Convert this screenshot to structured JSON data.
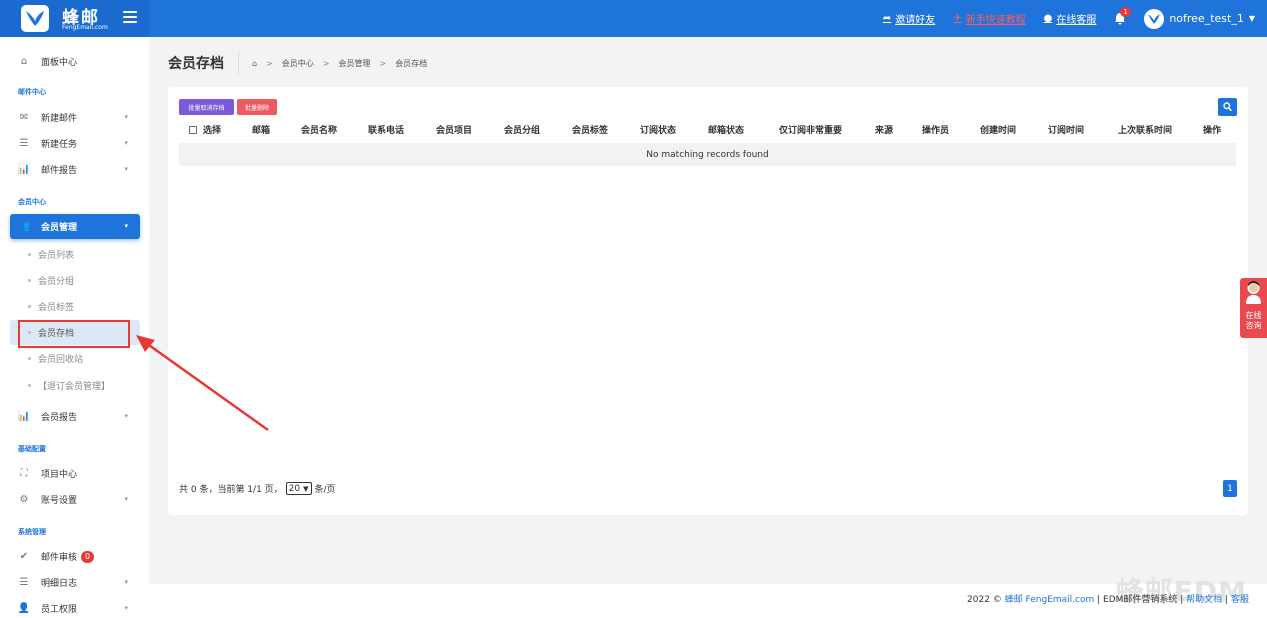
{
  "brand": {
    "name": "蜂邮",
    "domain": "FengEmail.com"
  },
  "header": {
    "invite": "邀请好友",
    "tutorial": "新手快速教程",
    "support": "在线客服",
    "notif_count": "1",
    "username": "nofree_test_1"
  },
  "sidebar": {
    "dashboard": "面板中心",
    "group_mail": "邮件中心",
    "new_mail": "新建邮件",
    "new_task": "新建任务",
    "mail_report": "邮件报告",
    "group_member": "会员中心",
    "member_mgmt": "会员管理",
    "member_list": "会员列表",
    "member_group": "会员分组",
    "member_tag": "会员标签",
    "member_archive": "会员存档",
    "member_recycle": "会员回收站",
    "unsub_mgmt": "【退订会员管理】",
    "member_report": "会员报告",
    "group_config": "基础配置",
    "project_center": "项目中心",
    "account_settings": "账号设置",
    "group_system": "系统管理",
    "mail_review": "邮件审核",
    "mail_review_count": "0",
    "detail_log": "明细日志",
    "staff_perm": "员工权限"
  },
  "page": {
    "title": "会员存档",
    "breadcrumb": [
      "会员中心",
      "会员管理",
      "会员存档"
    ]
  },
  "toolbar": {
    "batch_unarchive": "批量取消存档",
    "batch_delete": "批量删除"
  },
  "table": {
    "select_label": "选择",
    "columns": [
      "邮箱",
      "会员名称",
      "联系电话",
      "会员项目",
      "会员分组",
      "会员标签",
      "订阅状态",
      "邮箱状态",
      "仅订阅非常重要",
      "来源",
      "操作员",
      "创建时间",
      "订阅时间",
      "上次联系时间",
      "操作"
    ],
    "empty": "No matching records found"
  },
  "pagination": {
    "summary": "共 0 条，当前第 1/1 页，",
    "page_size": "20",
    "per_page": "条/页",
    "current": "1"
  },
  "footer": {
    "watermark": "蜂邮EDM",
    "year": "2022 ©",
    "site": "蜂邮 FengEmail.com",
    "system": "| EDM邮件营销系统 |",
    "help": "帮助文档",
    "sep": "|",
    "service": "客服"
  },
  "float": {
    "label_1": "在线",
    "label_2": "咨询"
  },
  "colors": {
    "primary": "#1f74dc",
    "purple": "#7a5ad8",
    "danger": "#ee5a62"
  }
}
